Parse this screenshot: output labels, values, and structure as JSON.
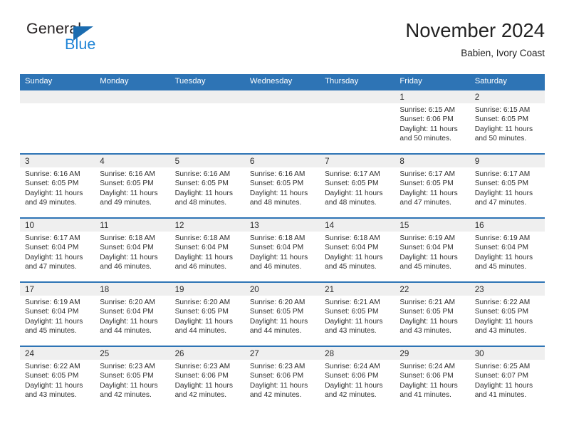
{
  "brand": {
    "name_part1": "General",
    "name_part2": "Blue",
    "triangle_color": "#1b6cb0",
    "blue_color": "#1f84d6"
  },
  "header": {
    "title": "November 2024",
    "subtitle": "Babien, Ivory Coast"
  },
  "theme": {
    "header_blue": "#2e74b5",
    "day_band_gray": "#efefef",
    "text_color": "#2f2f2f"
  },
  "calendar": {
    "weekday_headers": [
      "Sunday",
      "Monday",
      "Tuesday",
      "Wednesday",
      "Thursday",
      "Friday",
      "Saturday"
    ],
    "weeks": [
      [
        {
          "day": "",
          "empty": true
        },
        {
          "day": "",
          "empty": true
        },
        {
          "day": "",
          "empty": true
        },
        {
          "day": "",
          "empty": true
        },
        {
          "day": "",
          "empty": true
        },
        {
          "day": "1",
          "sunrise": "Sunrise: 6:15 AM",
          "sunset": "Sunset: 6:06 PM",
          "daylight_line1": "Daylight: 11 hours",
          "daylight_line2": "and 50 minutes."
        },
        {
          "day": "2",
          "sunrise": "Sunrise: 6:15 AM",
          "sunset": "Sunset: 6:05 PM",
          "daylight_line1": "Daylight: 11 hours",
          "daylight_line2": "and 50 minutes."
        }
      ],
      [
        {
          "day": "3",
          "sunrise": "Sunrise: 6:16 AM",
          "sunset": "Sunset: 6:05 PM",
          "daylight_line1": "Daylight: 11 hours",
          "daylight_line2": "and 49 minutes."
        },
        {
          "day": "4",
          "sunrise": "Sunrise: 6:16 AM",
          "sunset": "Sunset: 6:05 PM",
          "daylight_line1": "Daylight: 11 hours",
          "daylight_line2": "and 49 minutes."
        },
        {
          "day": "5",
          "sunrise": "Sunrise: 6:16 AM",
          "sunset": "Sunset: 6:05 PM",
          "daylight_line1": "Daylight: 11 hours",
          "daylight_line2": "and 48 minutes."
        },
        {
          "day": "6",
          "sunrise": "Sunrise: 6:16 AM",
          "sunset": "Sunset: 6:05 PM",
          "daylight_line1": "Daylight: 11 hours",
          "daylight_line2": "and 48 minutes."
        },
        {
          "day": "7",
          "sunrise": "Sunrise: 6:17 AM",
          "sunset": "Sunset: 6:05 PM",
          "daylight_line1": "Daylight: 11 hours",
          "daylight_line2": "and 48 minutes."
        },
        {
          "day": "8",
          "sunrise": "Sunrise: 6:17 AM",
          "sunset": "Sunset: 6:05 PM",
          "daylight_line1": "Daylight: 11 hours",
          "daylight_line2": "and 47 minutes."
        },
        {
          "day": "9",
          "sunrise": "Sunrise: 6:17 AM",
          "sunset": "Sunset: 6:05 PM",
          "daylight_line1": "Daylight: 11 hours",
          "daylight_line2": "and 47 minutes."
        }
      ],
      [
        {
          "day": "10",
          "sunrise": "Sunrise: 6:17 AM",
          "sunset": "Sunset: 6:04 PM",
          "daylight_line1": "Daylight: 11 hours",
          "daylight_line2": "and 47 minutes."
        },
        {
          "day": "11",
          "sunrise": "Sunrise: 6:18 AM",
          "sunset": "Sunset: 6:04 PM",
          "daylight_line1": "Daylight: 11 hours",
          "daylight_line2": "and 46 minutes."
        },
        {
          "day": "12",
          "sunrise": "Sunrise: 6:18 AM",
          "sunset": "Sunset: 6:04 PM",
          "daylight_line1": "Daylight: 11 hours",
          "daylight_line2": "and 46 minutes."
        },
        {
          "day": "13",
          "sunrise": "Sunrise: 6:18 AM",
          "sunset": "Sunset: 6:04 PM",
          "daylight_line1": "Daylight: 11 hours",
          "daylight_line2": "and 46 minutes."
        },
        {
          "day": "14",
          "sunrise": "Sunrise: 6:18 AM",
          "sunset": "Sunset: 6:04 PM",
          "daylight_line1": "Daylight: 11 hours",
          "daylight_line2": "and 45 minutes."
        },
        {
          "day": "15",
          "sunrise": "Sunrise: 6:19 AM",
          "sunset": "Sunset: 6:04 PM",
          "daylight_line1": "Daylight: 11 hours",
          "daylight_line2": "and 45 minutes."
        },
        {
          "day": "16",
          "sunrise": "Sunrise: 6:19 AM",
          "sunset": "Sunset: 6:04 PM",
          "daylight_line1": "Daylight: 11 hours",
          "daylight_line2": "and 45 minutes."
        }
      ],
      [
        {
          "day": "17",
          "sunrise": "Sunrise: 6:19 AM",
          "sunset": "Sunset: 6:04 PM",
          "daylight_line1": "Daylight: 11 hours",
          "daylight_line2": "and 45 minutes."
        },
        {
          "day": "18",
          "sunrise": "Sunrise: 6:20 AM",
          "sunset": "Sunset: 6:04 PM",
          "daylight_line1": "Daylight: 11 hours",
          "daylight_line2": "and 44 minutes."
        },
        {
          "day": "19",
          "sunrise": "Sunrise: 6:20 AM",
          "sunset": "Sunset: 6:05 PM",
          "daylight_line1": "Daylight: 11 hours",
          "daylight_line2": "and 44 minutes."
        },
        {
          "day": "20",
          "sunrise": "Sunrise: 6:20 AM",
          "sunset": "Sunset: 6:05 PM",
          "daylight_line1": "Daylight: 11 hours",
          "daylight_line2": "and 44 minutes."
        },
        {
          "day": "21",
          "sunrise": "Sunrise: 6:21 AM",
          "sunset": "Sunset: 6:05 PM",
          "daylight_line1": "Daylight: 11 hours",
          "daylight_line2": "and 43 minutes."
        },
        {
          "day": "22",
          "sunrise": "Sunrise: 6:21 AM",
          "sunset": "Sunset: 6:05 PM",
          "daylight_line1": "Daylight: 11 hours",
          "daylight_line2": "and 43 minutes."
        },
        {
          "day": "23",
          "sunrise": "Sunrise: 6:22 AM",
          "sunset": "Sunset: 6:05 PM",
          "daylight_line1": "Daylight: 11 hours",
          "daylight_line2": "and 43 minutes."
        }
      ],
      [
        {
          "day": "24",
          "sunrise": "Sunrise: 6:22 AM",
          "sunset": "Sunset: 6:05 PM",
          "daylight_line1": "Daylight: 11 hours",
          "daylight_line2": "and 43 minutes."
        },
        {
          "day": "25",
          "sunrise": "Sunrise: 6:23 AM",
          "sunset": "Sunset: 6:05 PM",
          "daylight_line1": "Daylight: 11 hours",
          "daylight_line2": "and 42 minutes."
        },
        {
          "day": "26",
          "sunrise": "Sunrise: 6:23 AM",
          "sunset": "Sunset: 6:06 PM",
          "daylight_line1": "Daylight: 11 hours",
          "daylight_line2": "and 42 minutes."
        },
        {
          "day": "27",
          "sunrise": "Sunrise: 6:23 AM",
          "sunset": "Sunset: 6:06 PM",
          "daylight_line1": "Daylight: 11 hours",
          "daylight_line2": "and 42 minutes."
        },
        {
          "day": "28",
          "sunrise": "Sunrise: 6:24 AM",
          "sunset": "Sunset: 6:06 PM",
          "daylight_line1": "Daylight: 11 hours",
          "daylight_line2": "and 42 minutes."
        },
        {
          "day": "29",
          "sunrise": "Sunrise: 6:24 AM",
          "sunset": "Sunset: 6:06 PM",
          "daylight_line1": "Daylight: 11 hours",
          "daylight_line2": "and 41 minutes."
        },
        {
          "day": "30",
          "sunrise": "Sunrise: 6:25 AM",
          "sunset": "Sunset: 6:07 PM",
          "daylight_line1": "Daylight: 11 hours",
          "daylight_line2": "and 41 minutes."
        }
      ]
    ]
  }
}
